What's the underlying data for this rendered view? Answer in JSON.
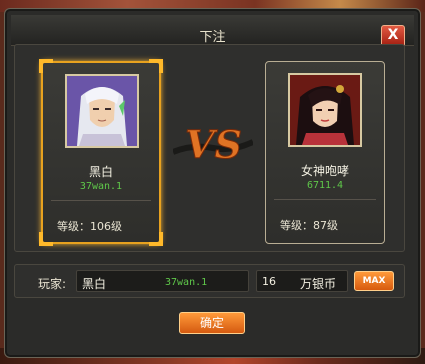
{
  "dialog": {
    "title": "下注",
    "close_label": "X",
    "close_icon": "close-icon"
  },
  "left_player": {
    "name": "黑白",
    "server": "37wan.1",
    "level": "等级：106级",
    "selected": true
  },
  "right_player": {
    "name": "女神咆哮",
    "server": "6711.4",
    "level": "等级：87级",
    "selected": false
  },
  "versus": {
    "icon": "vs-emblem"
  },
  "bet": {
    "player_label": "玩家:",
    "player_name": "黑白",
    "player_server": "37wan.1",
    "amount": "16",
    "unit": "万银币",
    "max_label": "MAX"
  },
  "confirm_label": "确定",
  "colors": {
    "accent_orange": "#e8731f",
    "server_green": "#5fc84a",
    "selection_gold": "#e8a21f"
  }
}
